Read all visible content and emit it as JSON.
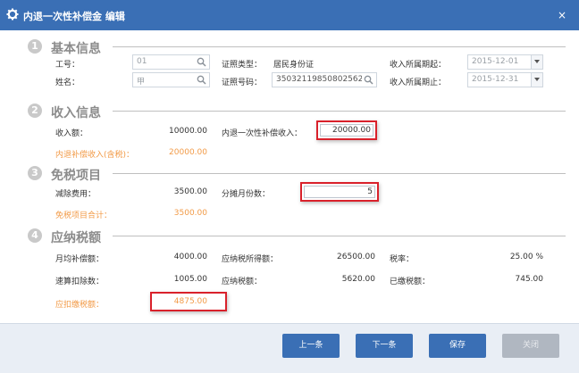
{
  "titlebar": {
    "title": "内退一次性补偿金 编辑",
    "close": "×"
  },
  "sections": {
    "basic": {
      "num": "1",
      "title": "基本信息"
    },
    "income": {
      "num": "2",
      "title": "收入信息"
    },
    "exempt": {
      "num": "3",
      "title": "免税项目"
    },
    "tax": {
      "num": "4",
      "title": "应纳税额"
    }
  },
  "basic": {
    "job_no_label": "工号：",
    "job_no_value": "01",
    "name_label": "姓名：",
    "name_value": "甲",
    "id_type_label": "证照类型：",
    "id_type_value": "居民身份证",
    "id_no_label": "证照号码：",
    "id_no_value": "35032119850802562",
    "period_start_label": "收入所属期起：",
    "period_start_value": "2015-12-01",
    "period_end_label": "收入所属期止：",
    "period_end_value": "2015-12-31"
  },
  "income": {
    "amount_label": "收入额：",
    "amount_value": "10000.00",
    "lump_label": "内退一次性补偿收入：",
    "lump_value": "20000.00",
    "taxed_label": "内退补偿收入(含税)：",
    "taxed_value": "20000.00"
  },
  "exempt": {
    "deduct_label": "减除费用：",
    "deduct_value": "3500.00",
    "months_label": "分摊月份数：",
    "months_value": "5",
    "total_label": "免税项目合计：",
    "total_value": "3500.00"
  },
  "tax": {
    "monthly_label": "月均补偿额：",
    "monthly_value": "4000.00",
    "taxable_label": "应纳税所得额：",
    "taxable_value": "26500.00",
    "rate_label": "税率：",
    "rate_value": "25.00 %",
    "quick_label": "速算扣除数：",
    "quick_value": "1005.00",
    "payable_label": "应纳税额：",
    "payable_value": "5620.00",
    "paid_label": "已缴税额：",
    "paid_value": "745.00",
    "withhold_label": "应扣缴税额：",
    "withhold_value": "4875.00"
  },
  "footer": {
    "prev": "上一条",
    "next": "下一条",
    "save": "保存",
    "close": "关闭"
  }
}
